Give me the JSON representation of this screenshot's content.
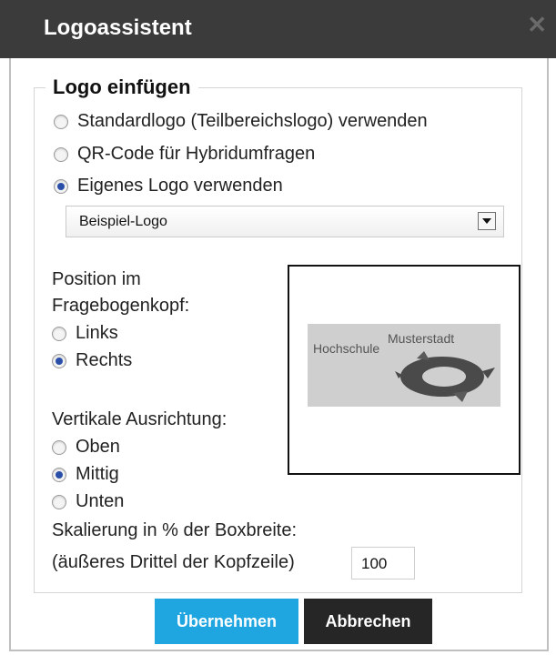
{
  "window": {
    "title": "Logoassistent",
    "close_glyph": "✕"
  },
  "section": {
    "legend": "Logo einfügen"
  },
  "logo_source": {
    "options": [
      {
        "label": "Standardlogo (Teilbereichslogo) verwenden",
        "selected": false
      },
      {
        "label": "QR-Code für Hybridumfragen",
        "selected": false
      },
      {
        "label": "Eigenes Logo verwenden",
        "selected": true
      }
    ],
    "select_value": "Beispiel-Logo"
  },
  "position": {
    "label_line1": "Position im",
    "label_line2": "Fragebogenkopf:",
    "options": [
      {
        "label": "Links",
        "selected": false
      },
      {
        "label": "Rechts",
        "selected": true
      }
    ]
  },
  "vertical": {
    "label": "Vertikale Ausrichtung:",
    "options": [
      {
        "label": "Oben",
        "selected": false
      },
      {
        "label": "Mittig",
        "selected": true
      },
      {
        "label": "Unten",
        "selected": false
      }
    ]
  },
  "scaling": {
    "label_line1": "Skalierung in % der Boxbreite:",
    "label_line2": "(äußeres Drittel der Kopfzeile)",
    "value": "100"
  },
  "preview": {
    "logo_text_top": "Musterstadt",
    "logo_text_left": "Hochschule"
  },
  "buttons": {
    "apply": "Übernehmen",
    "cancel": "Abbrechen"
  },
  "colors": {
    "titlebar": "#3b3b3b",
    "apply_bg": "#1fa6e0",
    "cancel_bg": "#262626",
    "radio_selected": "#2a4fa8"
  }
}
